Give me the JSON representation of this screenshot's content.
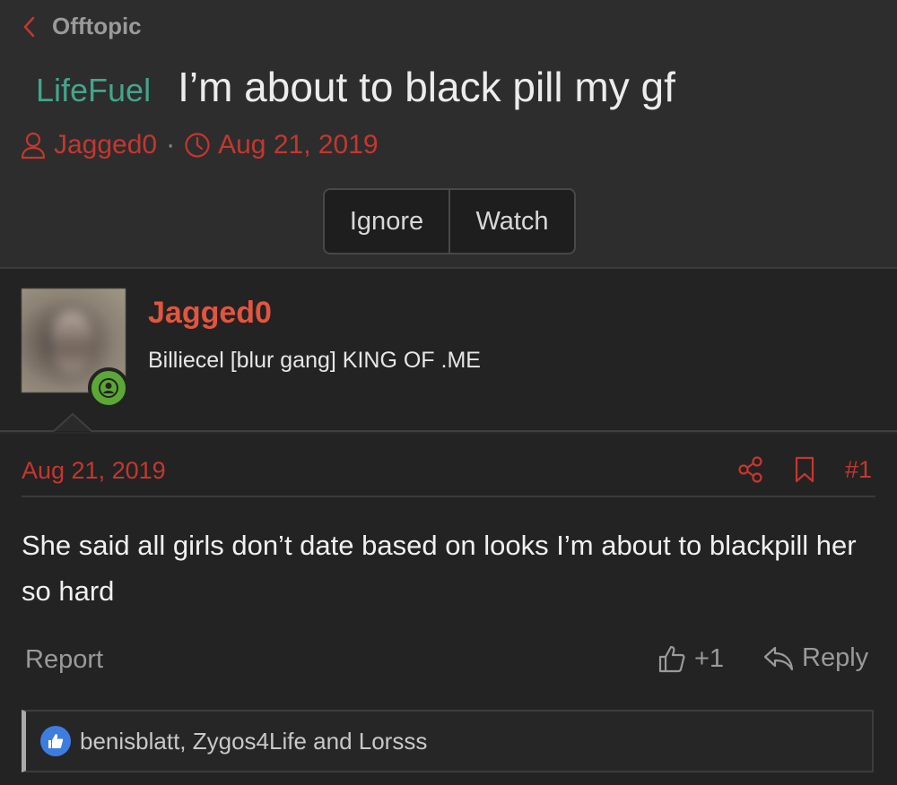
{
  "breadcrumb": {
    "label": "Offtopic"
  },
  "thread": {
    "prefix": "LifeFuel",
    "title": "I’m about to black pill my gf",
    "author": "Jagged0",
    "separator": "·",
    "date": "Aug 21, 2019"
  },
  "actions": {
    "ignore": "Ignore",
    "watch": "Watch"
  },
  "post": {
    "username": "Jagged0",
    "user_title": "Billiecel [blur gang] KING OF .ME",
    "date": "Aug 21, 2019",
    "number": "#1",
    "body": "She said all girls don’t date based on looks I’m about to blackpill her so hard",
    "report": "Report",
    "like_count": "+1",
    "reply": "Reply",
    "reactions_text": "benisblatt, Zygos4Life and Lorsss"
  },
  "colors": {
    "accent_red": "#c4372f",
    "prefix_green": "#45a48c",
    "username_red": "#e2553f",
    "online_green": "#5ba836",
    "like_blue": "#3d7de0"
  },
  "icons": [
    "chevron-left-icon",
    "user-icon",
    "clock-icon",
    "online-status-icon",
    "share-icon",
    "bookmark-icon",
    "thumbs-up-icon",
    "reply-icon",
    "like-reaction-icon"
  ]
}
